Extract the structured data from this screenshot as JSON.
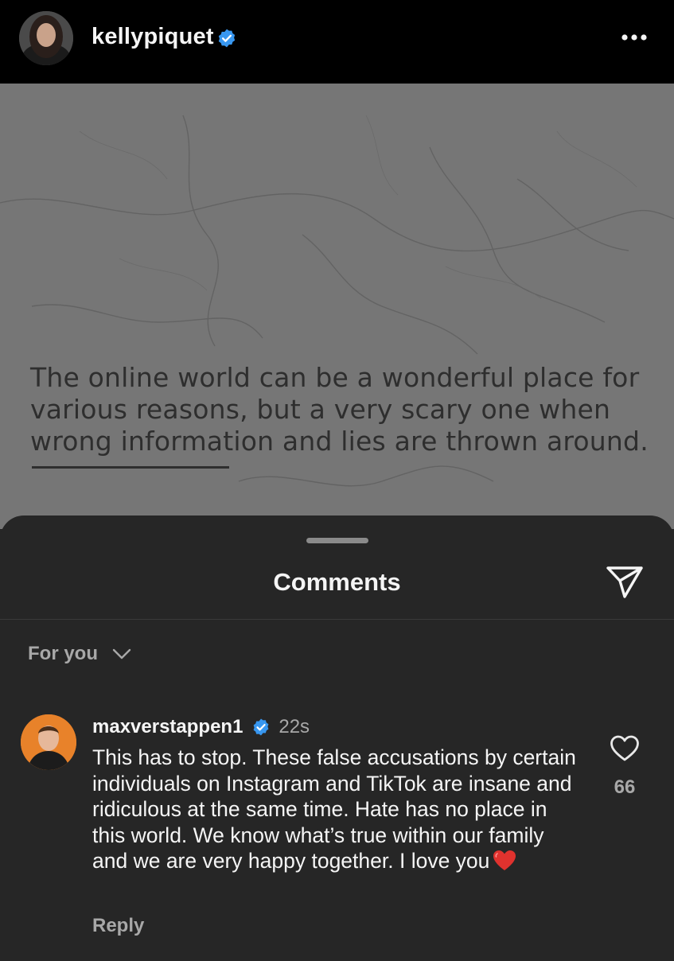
{
  "header": {
    "username": "kellypiquet",
    "avatar_icon": "profile-photo-avatar",
    "verified_icon": "verified-badge-icon",
    "more_icon": "more-options-icon"
  },
  "post": {
    "caption_lines": [
      "The online world can be a wonderful place for",
      "various reasons, but a very scary one when",
      "wrong information and lies are thrown around."
    ]
  },
  "comments_sheet": {
    "title": "Comments",
    "share_icon": "send-icon",
    "sort_label": "For you",
    "sort_icon": "chevron-down-icon"
  },
  "comment": {
    "username": "maxverstappen1",
    "time": "22s",
    "text": "This has to stop. These false accusations by certain individuals on Instagram and TikTok are insane and ridiculous at the same time. Hate has no place in this world. We know what’s true within our family and we are very happy together. I love you",
    "emoji_icon": "red-heart-emoji",
    "reply_label": "Reply",
    "like_icon": "heart-outline-icon",
    "like_count": "66"
  },
  "colors": {
    "header_bg": "#000000",
    "sheet_bg": "#262626",
    "verified_blue": "#3897f0",
    "secondary_text": "#a8a8a8",
    "primary_text": "#f5f5f5"
  }
}
